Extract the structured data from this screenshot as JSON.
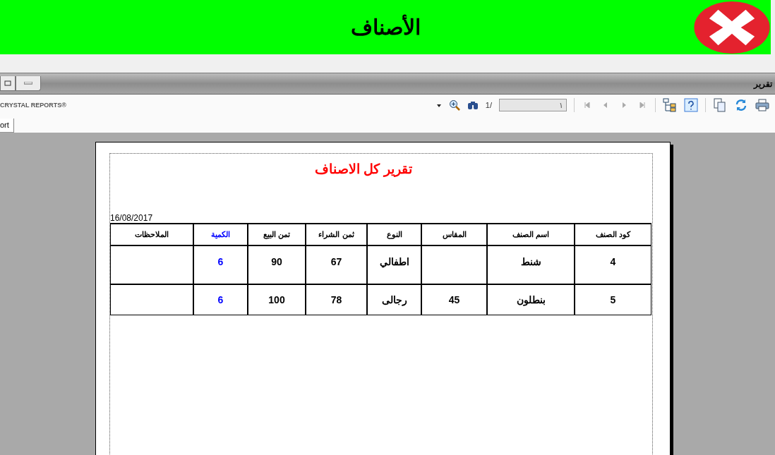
{
  "header": {
    "title": "الأصناف"
  },
  "window": {
    "title": "تقرير"
  },
  "toolbar": {
    "brand": "CRYSTAL REPORTS®",
    "page_label": "1/",
    "page_field": "١"
  },
  "tabs": [
    {
      "label": "ort",
      "selected": true
    }
  ],
  "report": {
    "title": "تقرير كل الاصناف",
    "date": "16/08/2017",
    "columns": [
      {
        "label": "كود الصنف",
        "color": "#000000"
      },
      {
        "label": "اسم الصنف",
        "color": "#000000"
      },
      {
        "label": "المقاس",
        "color": "#000000"
      },
      {
        "label": "النوع",
        "color": "#000000"
      },
      {
        "label": "ثمن الشراء",
        "color": "#000000"
      },
      {
        "label": "تمن البيع",
        "color": "#000000"
      },
      {
        "label": "الكمية",
        "color": "#0000ff"
      },
      {
        "label": "الملاحظات",
        "color": "#000000"
      }
    ],
    "rows": [
      [
        "4",
        "شنط",
        "",
        "اطفالي",
        "67",
        "90",
        "6",
        ""
      ],
      [
        "5",
        "بنطلون",
        "45",
        "رجالى",
        "78",
        "100",
        "6",
        ""
      ]
    ]
  }
}
